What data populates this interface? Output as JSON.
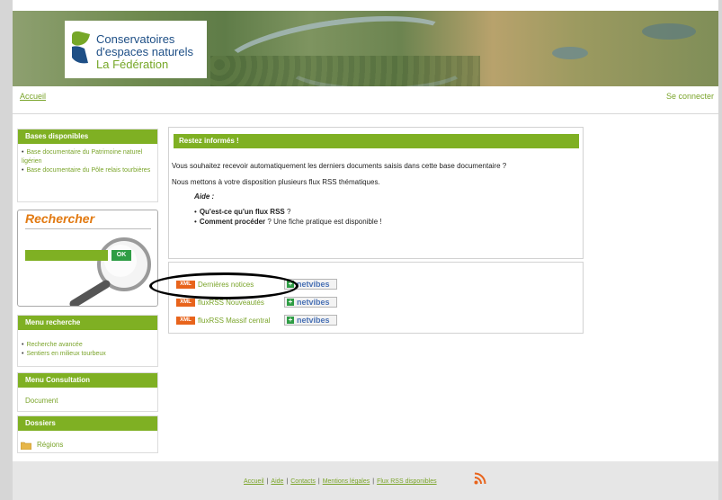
{
  "logo": {
    "line1": "Conservatoires",
    "line2": "d'espaces naturels",
    "line3": "La Fédération"
  },
  "topnav": {
    "home": "Accueil",
    "login": "Se connecter"
  },
  "sidebar": {
    "bases": {
      "title": "Bases disponibles",
      "items": [
        "Base documentaire du Patrimoine naturel ligérien",
        "Base documentaire du Pôle relais tourbières"
      ]
    },
    "search": {
      "title": "Rechercher",
      "input_value": "",
      "ok": "OK"
    },
    "menu_recherche": {
      "title": "Menu recherche",
      "items": [
        "Recherche avancée",
        "Sentiers en milieux tourbeux"
      ]
    },
    "menu_consultation": {
      "title": "Menu Consultation",
      "link": "Document"
    },
    "dossiers": {
      "title": "Dossiers",
      "link": "Régions"
    }
  },
  "main": {
    "info": {
      "title": "Restez informés !",
      "p1": "Vous souhaitez recevoir automatiquement les derniers documents saisis dans cette base documentaire ?",
      "p2": "Nous mettons à votre disposition plusieurs flux RSS thématiques.",
      "aide": "Aide :",
      "help": [
        {
          "bold": "Qu'est-ce qu'un flux RSS",
          "rest": " ?"
        },
        {
          "bold": "Comment procéder",
          "rest": " ? Une fiche pratique est disponible !"
        }
      ]
    },
    "feeds": {
      "badge": "XML",
      "netvibes": "netvibes",
      "items": [
        "Dernières notices",
        "fluxRSS Nouveautés",
        "fluxRSS Massif central"
      ]
    }
  },
  "footer": {
    "links": [
      "Accueil",
      "Aide",
      "Contacts",
      "Mentions légales",
      "Flux RSS disponibles"
    ],
    "separator": "|"
  },
  "colors": {
    "accent_green": "#7fb023",
    "link_green": "#7aa42a",
    "search_orange": "#e27a12",
    "xml_orange": "#e8641c"
  }
}
